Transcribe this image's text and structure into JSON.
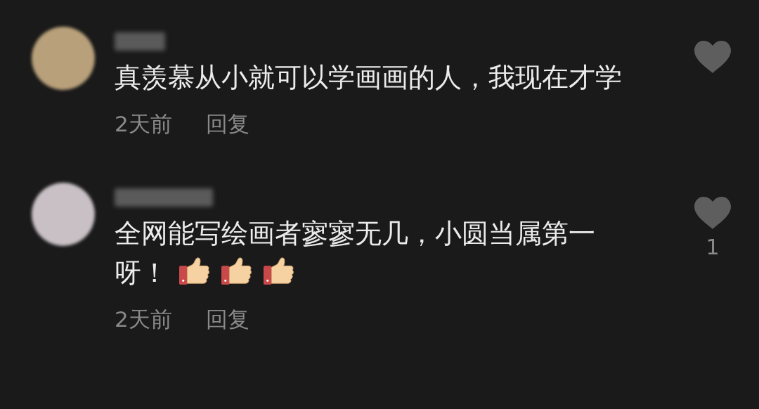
{
  "comments": [
    {
      "text": "真羡慕从小就可以学画画的人，我现在才学",
      "time": "2天前",
      "reply": "回复"
    },
    {
      "text": "全网能写绘画者寥寥无几，小圆当属第一呀！",
      "emojis": [
        {
          "kind": "thumbs-up"
        },
        {
          "kind": "thumbs-up"
        },
        {
          "kind": "thumbs-up"
        }
      ],
      "time": "2天前",
      "reply": "回复",
      "likes": "1"
    }
  ]
}
